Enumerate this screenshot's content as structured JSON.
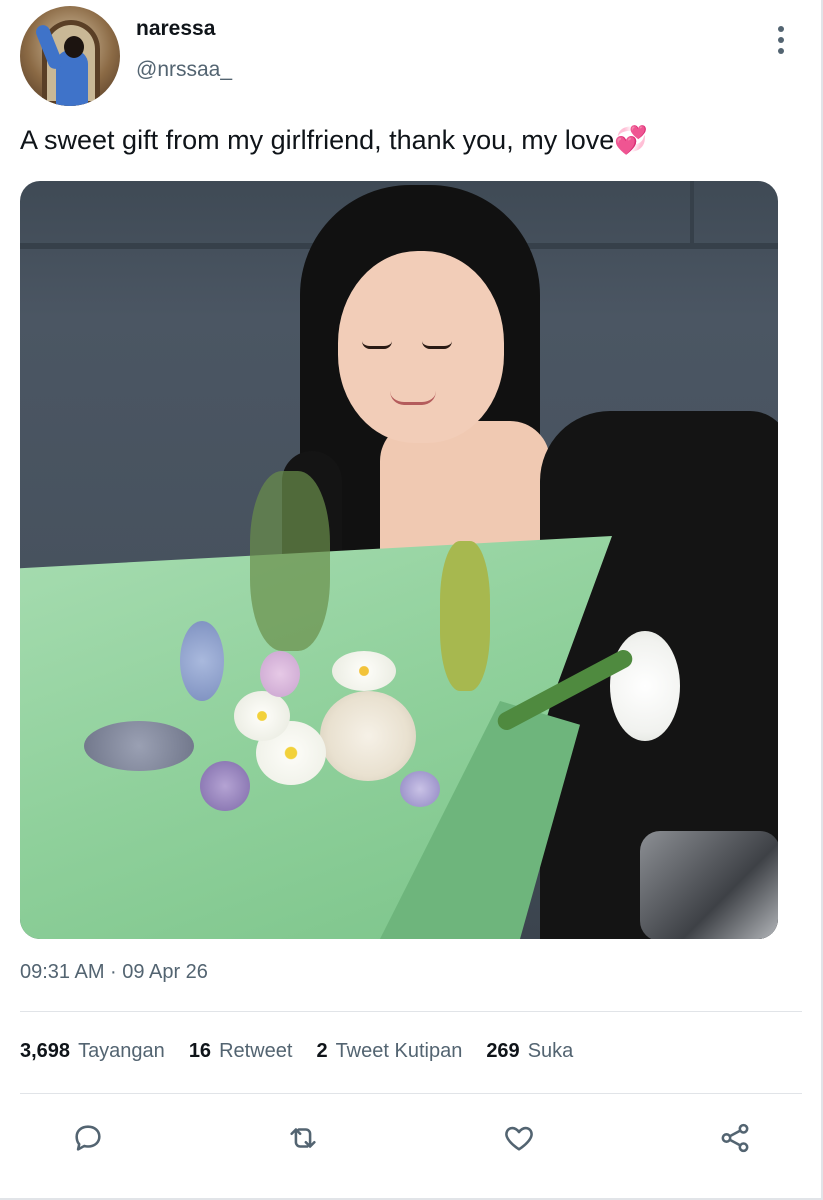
{
  "author": {
    "display_name": "naressa",
    "handle": "@nrssaa_"
  },
  "tweet": {
    "text": "A sweet gift from my girlfriend, thank you, my love💞",
    "timestamp": "09:31 AM · 09 Apr 26"
  },
  "stats": {
    "views": {
      "count": "3,698",
      "label": "Tayangan"
    },
    "retweets": {
      "count": "16",
      "label": "Retweet"
    },
    "quotes": {
      "count": "2",
      "label": "Tweet Kutipan"
    },
    "likes": {
      "count": "269",
      "label": "Suka"
    }
  },
  "icons": {
    "more": "more-vertical-icon",
    "reply": "reply-icon",
    "retweet": "retweet-icon",
    "like": "heart-icon",
    "share": "share-icon"
  },
  "colors": {
    "text_primary": "#0f1419",
    "text_secondary": "#536471",
    "divider": "#e1e4e8",
    "bouquet_paper": "#8fd09b"
  }
}
